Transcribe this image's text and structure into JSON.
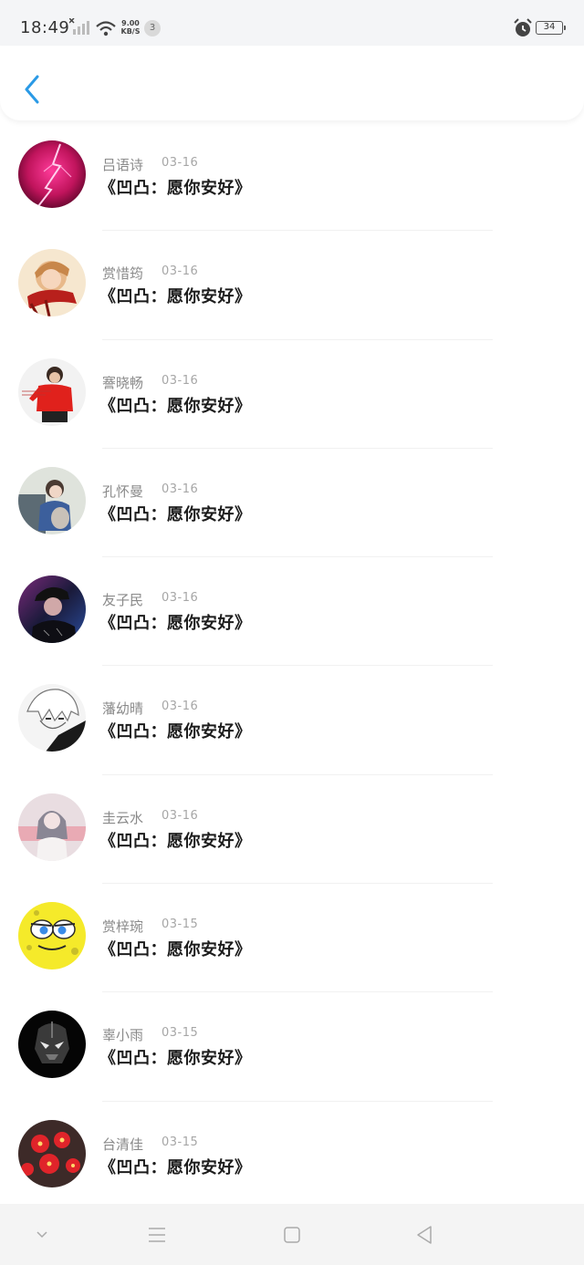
{
  "status_bar": {
    "time": "18:49",
    "speed_value": "9.00",
    "speed_unit": "KB/S",
    "notification_count": "3",
    "battery": "34"
  },
  "header": {
    "back_icon": "chevron-left-icon",
    "accent_color": "#2a9ae6"
  },
  "list": [
    {
      "name": "吕语诗",
      "date": "03-16",
      "title": "《凹凸：愿你安好》",
      "avatar": "lightning"
    },
    {
      "name": "赏惜筠",
      "date": "03-16",
      "title": "《凹凸：愿你安好》",
      "avatar": "scarf-person"
    },
    {
      "name": "謇晓畅",
      "date": "03-16",
      "title": "《凹凸：愿你安好》",
      "avatar": "red-shirt-person"
    },
    {
      "name": "孔怀曼",
      "date": "03-16",
      "title": "《凹凸：愿你安好》",
      "avatar": "girl-sitting"
    },
    {
      "name": "友子民",
      "date": "03-16",
      "title": "《凹凸：愿你安好》",
      "avatar": "dark-portrait"
    },
    {
      "name": "藩幼晴",
      "date": "03-16",
      "title": "《凹凸：愿你安好》",
      "avatar": "anime-bw"
    },
    {
      "name": "圭云水",
      "date": "03-16",
      "title": "《凹凸：愿你安好》",
      "avatar": "pink-girl"
    },
    {
      "name": "赏梓琬",
      "date": "03-15",
      "title": "《凹凸：愿你安好》",
      "avatar": "spongebob"
    },
    {
      "name": "辜小雨",
      "date": "03-15",
      "title": "《凹凸：愿你安好》",
      "avatar": "dark-helmet"
    },
    {
      "name": "台清佳",
      "date": "03-15",
      "title": "《凹凸：愿你安好》",
      "avatar": "red-flowers"
    }
  ],
  "nav_bar": {
    "icons": [
      "chevron-down-icon",
      "menu-icon",
      "home-square-icon",
      "back-triangle-icon"
    ]
  }
}
